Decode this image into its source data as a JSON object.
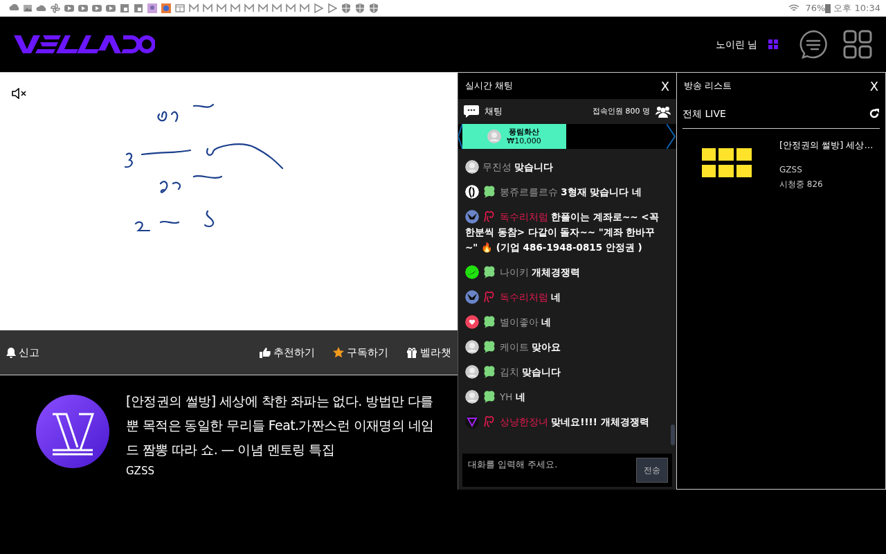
{
  "status_bar": {
    "battery": "76%",
    "time": "오후 10:34"
  },
  "header": {
    "user": "노이린 님"
  },
  "video": {
    "muted": true
  },
  "actions": {
    "report": "신고",
    "buttons": [
      {
        "kind": "like",
        "label": "추천하기"
      },
      {
        "kind": "subscribe",
        "label": "구독하기"
      },
      {
        "kind": "gift",
        "label": "벨라챗"
      }
    ]
  },
  "stream_info": {
    "title": "[안정권의 썰방] 세상에 착한 좌파는 없다. 방법만 다를 뿐 목적은 동일한 무리들 Feat.가짠스런 이재명의 네임드 짬뽕 따라 쇼. — 이념 멘토링 특집",
    "channel": "GZSS"
  },
  "chat": {
    "title": "실시간 채팅",
    "close": "X",
    "tab": "채팅",
    "viewers": "접속인원 800 명",
    "donation": {
      "name": "풍림화산",
      "amount": "₩10,000"
    },
    "messages": [
      {
        "avatar": {
          "kind": "default"
        },
        "name": "무진성",
        "color": "#9a9a9a",
        "text": "맞습니다"
      },
      {
        "avatar": {
          "kind": "figure"
        },
        "badge": {
          "kind": "clover"
        },
        "name": "봉쥬르를르슈",
        "color": "#9a9a9a",
        "text": "3형재 맞습니다 네"
      },
      {
        "avatar": {
          "kind": "eagle"
        },
        "badge": {
          "kind": "ribbon"
        },
        "name": "독수리처럼",
        "color": "#e8194f",
        "text": "한풀이는 계좌로~~ <꼭 한분씩 동참> 다같이 돌자~~ \"계좌 한바꾸~\" 🔥 (기업 486-1948-0815 안정권 )"
      },
      {
        "avatar": {
          "kind": "swoosh"
        },
        "badge": {
          "kind": "clover"
        },
        "name": "나이키",
        "color": "#9a9a9a",
        "text": "개체경쟁력"
      },
      {
        "avatar": {
          "kind": "eagle"
        },
        "badge": {
          "kind": "ribbon"
        },
        "name": "독수리처럼",
        "color": "#e8194f",
        "text": "네"
      },
      {
        "avatar": {
          "kind": "heart"
        },
        "badge": {
          "kind": "clover"
        },
        "name": "별이좋아",
        "color": "#9a9a9a",
        "text": "네"
      },
      {
        "avatar": {
          "kind": "default"
        },
        "badge": {
          "kind": "clover"
        },
        "name": "케이트",
        "color": "#9a9a9a",
        "text": "맞아요"
      },
      {
        "avatar": {
          "kind": "default"
        },
        "badge": {
          "kind": "clover"
        },
        "name": "김치",
        "color": "#9a9a9a",
        "text": "맞습니다"
      },
      {
        "avatar": {
          "kind": "default"
        },
        "badge": {
          "kind": "clover"
        },
        "name": "YH",
        "color": "#9a9a9a",
        "text": "네"
      },
      {
        "avatar": {
          "kind": "triangle"
        },
        "badge": {
          "kind": "ribbon"
        },
        "name": "상냥한장녀",
        "color": "#e8194f",
        "text": "맞네요!!!! 개체경쟁력"
      }
    ],
    "input": {
      "placeholder": "대화를 입력해 주세요."
    },
    "send": "전송"
  },
  "broadcast_list": {
    "title": "방송 리스트",
    "close": "X",
    "filter": "전체 LIVE",
    "items": [
      {
        "title": "[안정권의 썰방] 세상…",
        "channel": "GZSS",
        "viewers": "시청중 826"
      }
    ]
  }
}
